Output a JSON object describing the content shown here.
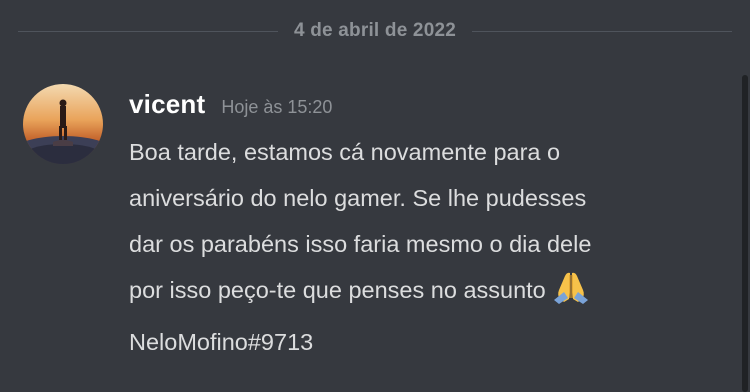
{
  "divider": {
    "date": "4 de abril de 2022"
  },
  "message": {
    "username": "vicent",
    "timestamp": "Hoje às 15:20",
    "lines": [
      "Boa tarde, estamos cá novamente para o",
      "aniversário do nelo gamer. Se lhe pudesses",
      "dar os parabéns isso faria mesmo o dia dele",
      "por isso peço-te que penses no assunto",
      "NeloMofino#9713"
    ],
    "emoji": "folded-hands-icon"
  },
  "colors": {
    "background": "#36393f",
    "username": "#ffffff",
    "text": "#dcddde",
    "muted": "#8e9297"
  }
}
